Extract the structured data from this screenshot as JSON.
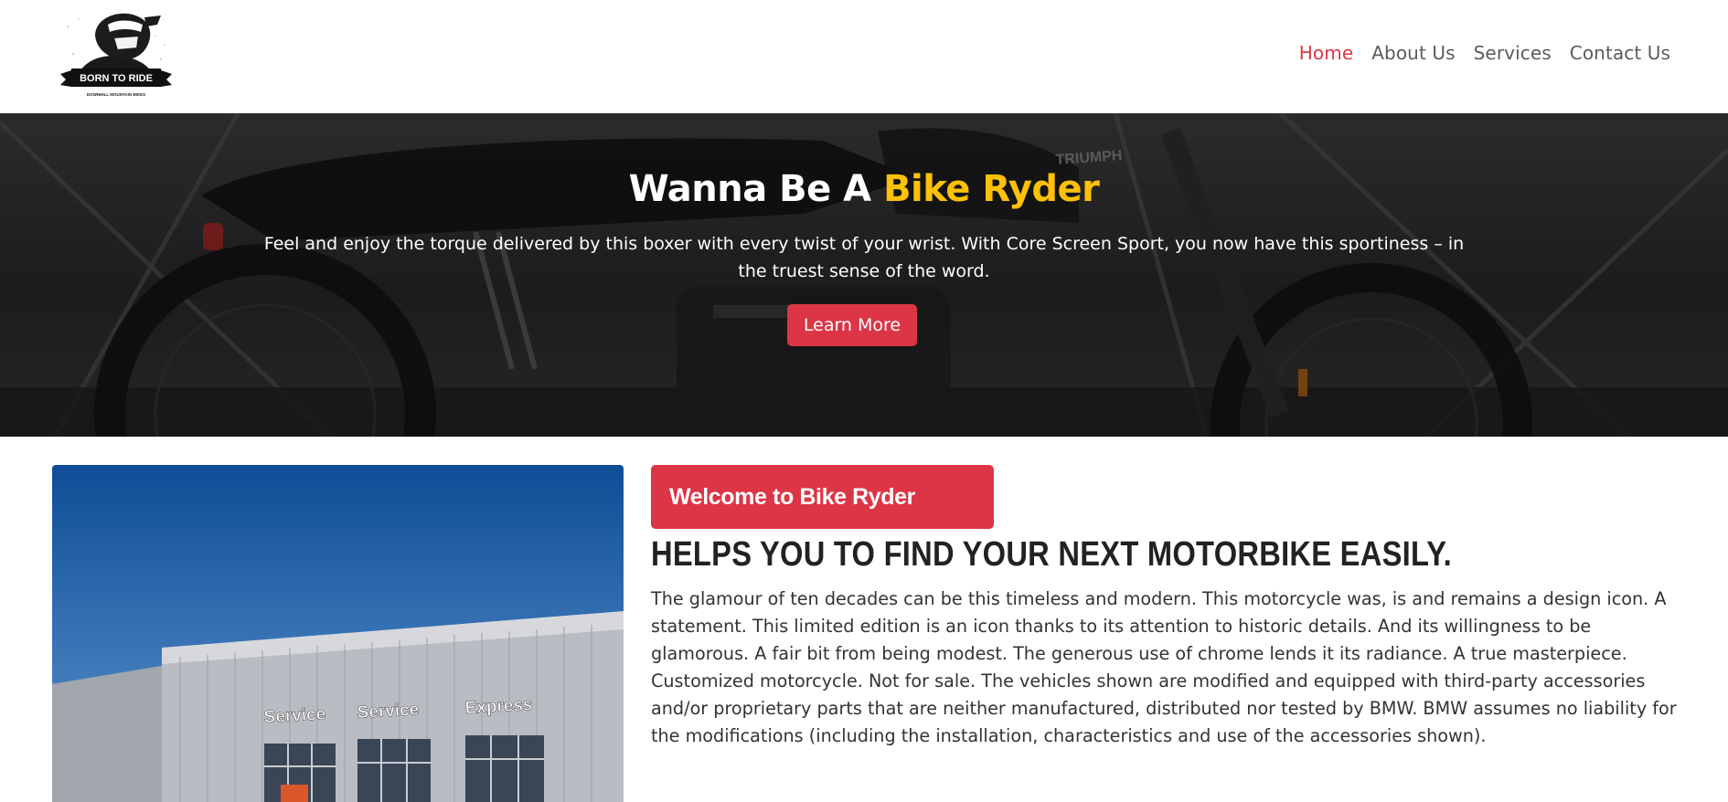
{
  "logo": {
    "text": "BORN TO RIDE",
    "subtext": "DOWNHILL MOUNTAIN BIKES"
  },
  "nav": {
    "items": [
      "Home",
      "About Us",
      "Services",
      "Contact Us"
    ],
    "active": "Home"
  },
  "hero": {
    "title_prefix": "Wanna Be A ",
    "title_highlight": "Bike Ryder",
    "text": "Feel and enjoy the torque delivered by this boxer with every twist of your wrist. With Core Screen Sport, you now have this sportiness – in the truest sense of the word.",
    "button": "Learn More",
    "background_label": "TRIUMPH"
  },
  "about": {
    "badge": "Welcome to Bike Ryder",
    "headline": "HELPS YOU TO FIND YOUR NEXT MOTORBIKE EASILY.",
    "paragraph": "The glamour of ten decades can be this timeless and modern. This motorcycle was, is and remains a design icon. A statement. This limited edition is an icon thanks to its attention to historic details. And its willingness to be glamorous. A fair bit from being modest. The generous use of chrome lends it its radiance. A true masterpiece. Customized motorcycle. Not for sale. The vehicles shown are modified and equipped with third-party accessories and/or proprietary parts that are neither manufactured, distributed nor tested by BMW. BMW assumes no liability for the modifications (including the installation, characteristics and use of the accessories shown).",
    "photo_signs": [
      "Service",
      "Service",
      "Express"
    ]
  },
  "colors": {
    "accent": "#dc3545",
    "highlight": "#ffc107",
    "nav_text": "#5b5b5b"
  }
}
